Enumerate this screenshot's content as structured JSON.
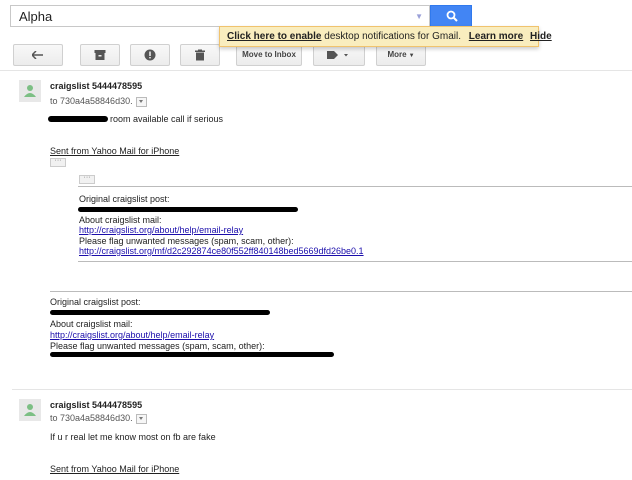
{
  "search": {
    "value": "Alpha"
  },
  "notification": {
    "enable_link": "Click here to enable",
    "text": "desktop notifications for Gmail.",
    "learn_more": "Learn more",
    "hide": "Hide"
  },
  "toolbar": {
    "move_to_inbox": "Move to Inbox",
    "more": "More"
  },
  "messages": [
    {
      "sender": "craigslist 5444478595",
      "to": "to 730a4a58846d30.",
      "body": "room available call if serious",
      "signature": "Sent from Yahoo Mail for iPhone",
      "quoted_inner": {
        "original_label": "Original craigslist post:",
        "about_label": "About craigslist mail:",
        "about_link": "http://craigslist.org/about/help/email-relay",
        "flag_label": "Please flag unwanted messages (spam, scam, other):",
        "flag_link": "http://craigslist.org/mf/d2c292874ce80f552ff840148bed5669dfd26be0.1"
      },
      "quoted_outer": {
        "original_label": "Original craigslist post:",
        "about_label": "About craigslist mail:",
        "about_link": "http://craigslist.org/about/help/email-relay",
        "flag_label": "Please flag unwanted messages (spam, scam, other):"
      }
    },
    {
      "sender": "craigslist 5444478595",
      "to": "to 730a4a58846d30.",
      "body": "If u r real let me know most on fb are fake",
      "signature": "Sent from Yahoo Mail for iPhone"
    }
  ]
}
